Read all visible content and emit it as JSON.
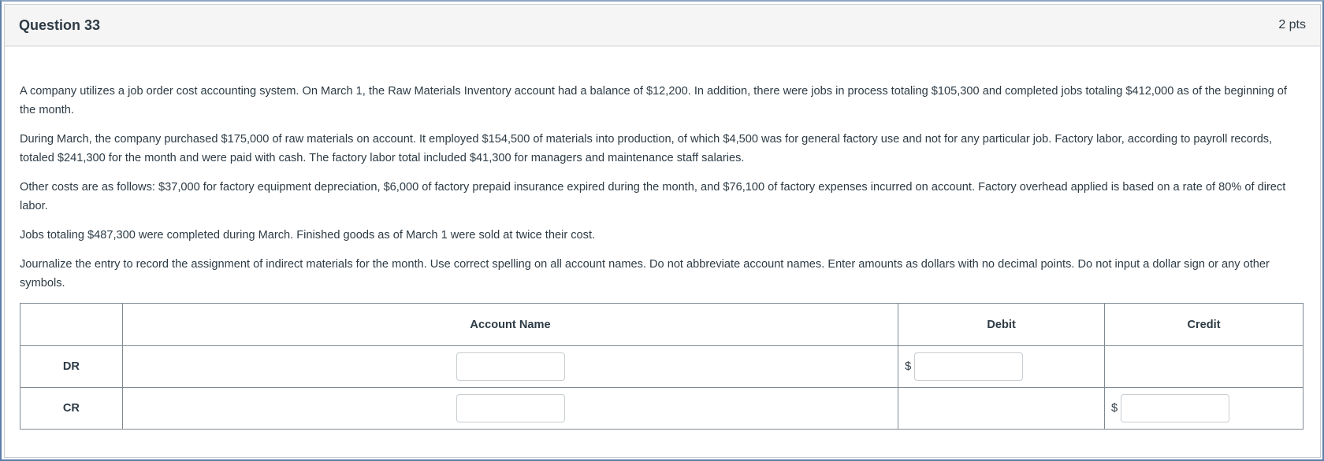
{
  "question": {
    "title": "Question 33",
    "points": "2 pts",
    "paragraphs": [
      "A company utilizes a job order cost accounting system. On March 1, the Raw Materials Inventory account had a balance of $12,200. In addition, there were jobs in process totaling $105,300 and completed jobs totaling $412,000 as of the beginning of the month.",
      "During March, the company purchased $175,000 of raw materials on account. It employed $154,500 of materials into production, of which $4,500 was for general factory use and not for any particular job. Factory labor, according to payroll records, totaled $241,300 for the month and were paid with cash. The factory labor total included $41,300 for managers and maintenance staff salaries.",
      "Other costs are as follows: $37,000 for factory equipment depreciation, $6,000 of factory prepaid insurance expired during the month, and $76,100 of factory expenses incurred on account. Factory overhead applied is based on a rate of 80% of direct labor.",
      "Jobs totaling $487,300 were completed during March. Finished goods as of March 1 were sold at twice their cost.",
      "Journalize the entry to record the assignment of indirect materials for the month. Use correct spelling on all account names. Do not abbreviate account names. Enter amounts as dollars with no decimal points. Do not input a dollar sign or any other symbols."
    ]
  },
  "journal": {
    "headers": {
      "row": "",
      "account": "Account Name",
      "debit": "Debit",
      "credit": "Credit"
    },
    "rows": [
      {
        "label": "DR",
        "account": "",
        "debit": "",
        "credit": ""
      },
      {
        "label": "CR",
        "account": "",
        "debit": "",
        "credit": ""
      }
    ],
    "currency_symbol": "$"
  }
}
